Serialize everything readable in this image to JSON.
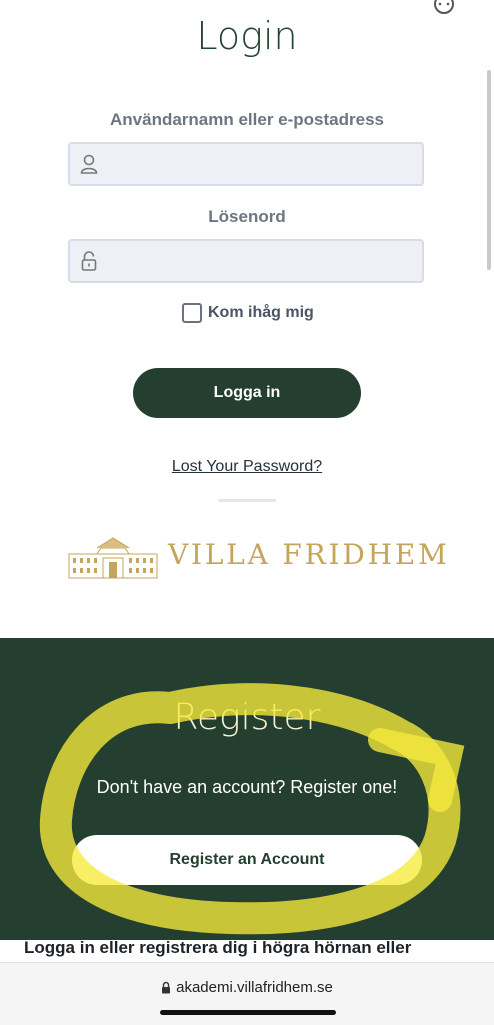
{
  "login": {
    "title": "Login",
    "username_label": "Användarnamn eller e-postadress",
    "username_value": "",
    "password_label": "Lösenord",
    "password_value": "",
    "remember_label": "Kom ihåg mig",
    "remember_checked": false,
    "submit_label": "Logga in",
    "lost_password_link": "Lost Your Password?"
  },
  "logo": {
    "text": "VILLA FRIDHEM",
    "color": "#c5a45c"
  },
  "register": {
    "title": "Register",
    "subtitle": "Don't have an account? Register one!",
    "button_label": "Register an Account",
    "background": "#243f2f"
  },
  "footer": {
    "text": "Logga in eller registrera dig i högra hörnan eller"
  },
  "browser": {
    "url": "akademi.villafridhem.se"
  },
  "icons": [
    "user-icon",
    "lock-icon",
    "settings-icon",
    "house-icon"
  ],
  "colors": {
    "brand_green": "#243f2f",
    "highlight": "#f7ea3c"
  }
}
